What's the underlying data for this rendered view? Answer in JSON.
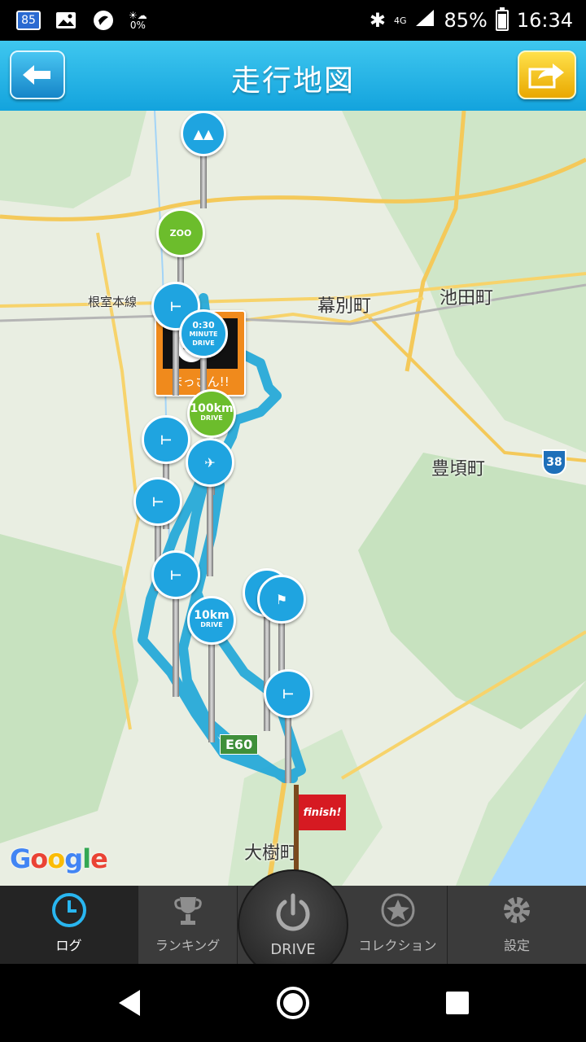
{
  "status_bar": {
    "notification_badge": "85",
    "network": "4G",
    "battery": "85%",
    "time": "16:34",
    "weather_text": "0%"
  },
  "header": {
    "title": "走行地図",
    "back_icon": "arrow-left-icon",
    "share_icon": "share-arrow-icon"
  },
  "map": {
    "labels": {
      "town1": "幕別町",
      "town2": "池田町",
      "town3": "豊頃町",
      "town4": "大樹町",
      "rail": "根室本線",
      "route_number": "38",
      "expressway": "E60"
    },
    "memo_caption": "まっさん!!",
    "pins": {
      "minute_drive": "0:30",
      "minute_drive_sub": "MINUTE DRIVE",
      "drive_100": "100km",
      "drive_100_sub": "DRIVE",
      "drive_10": "10km",
      "drive_10_sub": "DRIVE",
      "zoo": "ZOO"
    },
    "finish_label": "finish!",
    "attribution": "Google",
    "route_color": "#27a9d8"
  },
  "tabs": {
    "log": "ログ",
    "ranking": "ランキング",
    "drive": "DRIVE",
    "collection": "コレクション",
    "settings": "設定"
  }
}
